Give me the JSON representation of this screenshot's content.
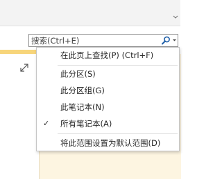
{
  "search": {
    "placeholder": "搜索(Ctrl+E)",
    "icon": "magnifier-icon",
    "dropdown_icon": "chevron-down-icon"
  },
  "menu": {
    "items": [
      {
        "label": "在此页上查找(P) (Ctrl+F)",
        "checked": false
      },
      {
        "label": "此分区(S)",
        "checked": false
      },
      {
        "label": "此分区组(G)",
        "checked": false
      },
      {
        "label": "此笔记本(N)",
        "checked": false
      },
      {
        "label": "所有笔记本(A)",
        "checked": true
      },
      {
        "label": "将此范围设置为默认范围(D)",
        "checked": false
      }
    ],
    "check_glyph": "✓"
  },
  "colors": {
    "note_background": "#fdf5e1",
    "note_accent": "#f7d57a",
    "search_icon": "#1f5fa8"
  }
}
